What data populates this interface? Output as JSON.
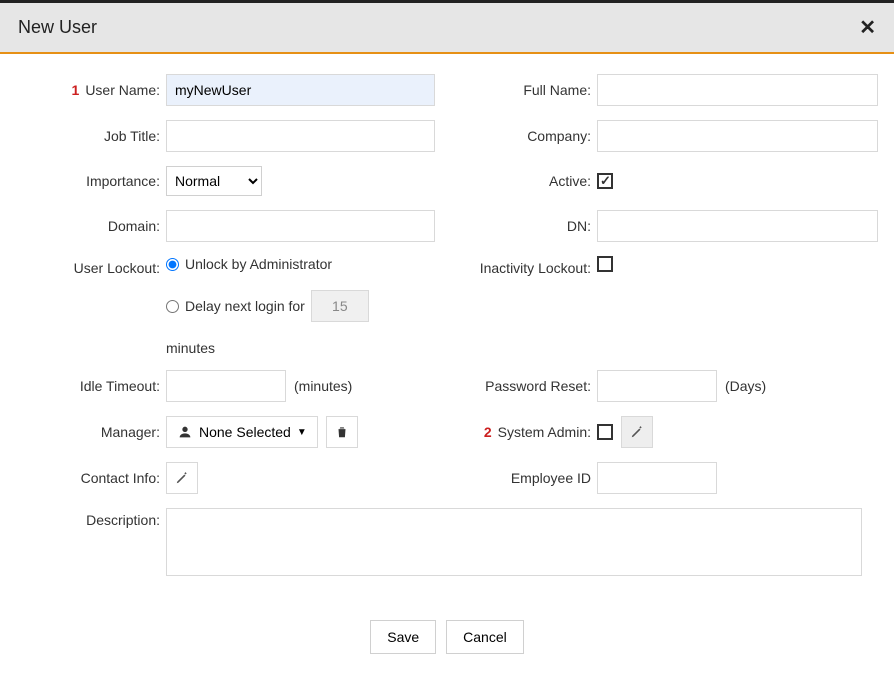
{
  "dialog": {
    "title": "New User"
  },
  "callouts": {
    "one": "1",
    "two": "2"
  },
  "labels": {
    "userName": "User Name:",
    "fullName": "Full Name:",
    "jobTitle": "Job Title:",
    "company": "Company:",
    "importance": "Importance:",
    "active": "Active:",
    "domain": "Domain:",
    "dn": "DN:",
    "userLockout": "User Lockout:",
    "inactivityLockout": "Inactivity Lockout:",
    "idleTimeout": "Idle Timeout:",
    "passwordReset": "Password Reset:",
    "manager": "Manager:",
    "systemAdmin": "System Admin:",
    "contactInfo": "Contact Info:",
    "employeeId": "Employee ID",
    "description": "Description:"
  },
  "values": {
    "userName": "myNewUser",
    "fullName": "",
    "jobTitle": "",
    "company": "",
    "importance": "Normal",
    "domain": "",
    "dn": "",
    "delayMinutes": "15",
    "idleTimeout": "",
    "passwordReset": "",
    "employeeId": "",
    "description": ""
  },
  "lockout": {
    "unlockByAdmin": "Unlock by Administrator",
    "delayPrefix": "Delay next login for",
    "delaySuffix": "minutes"
  },
  "suffix": {
    "minutes": "(minutes)",
    "days": "(Days)"
  },
  "manager": {
    "noneSelected": "None Selected"
  },
  "buttons": {
    "save": "Save",
    "cancel": "Cancel"
  }
}
